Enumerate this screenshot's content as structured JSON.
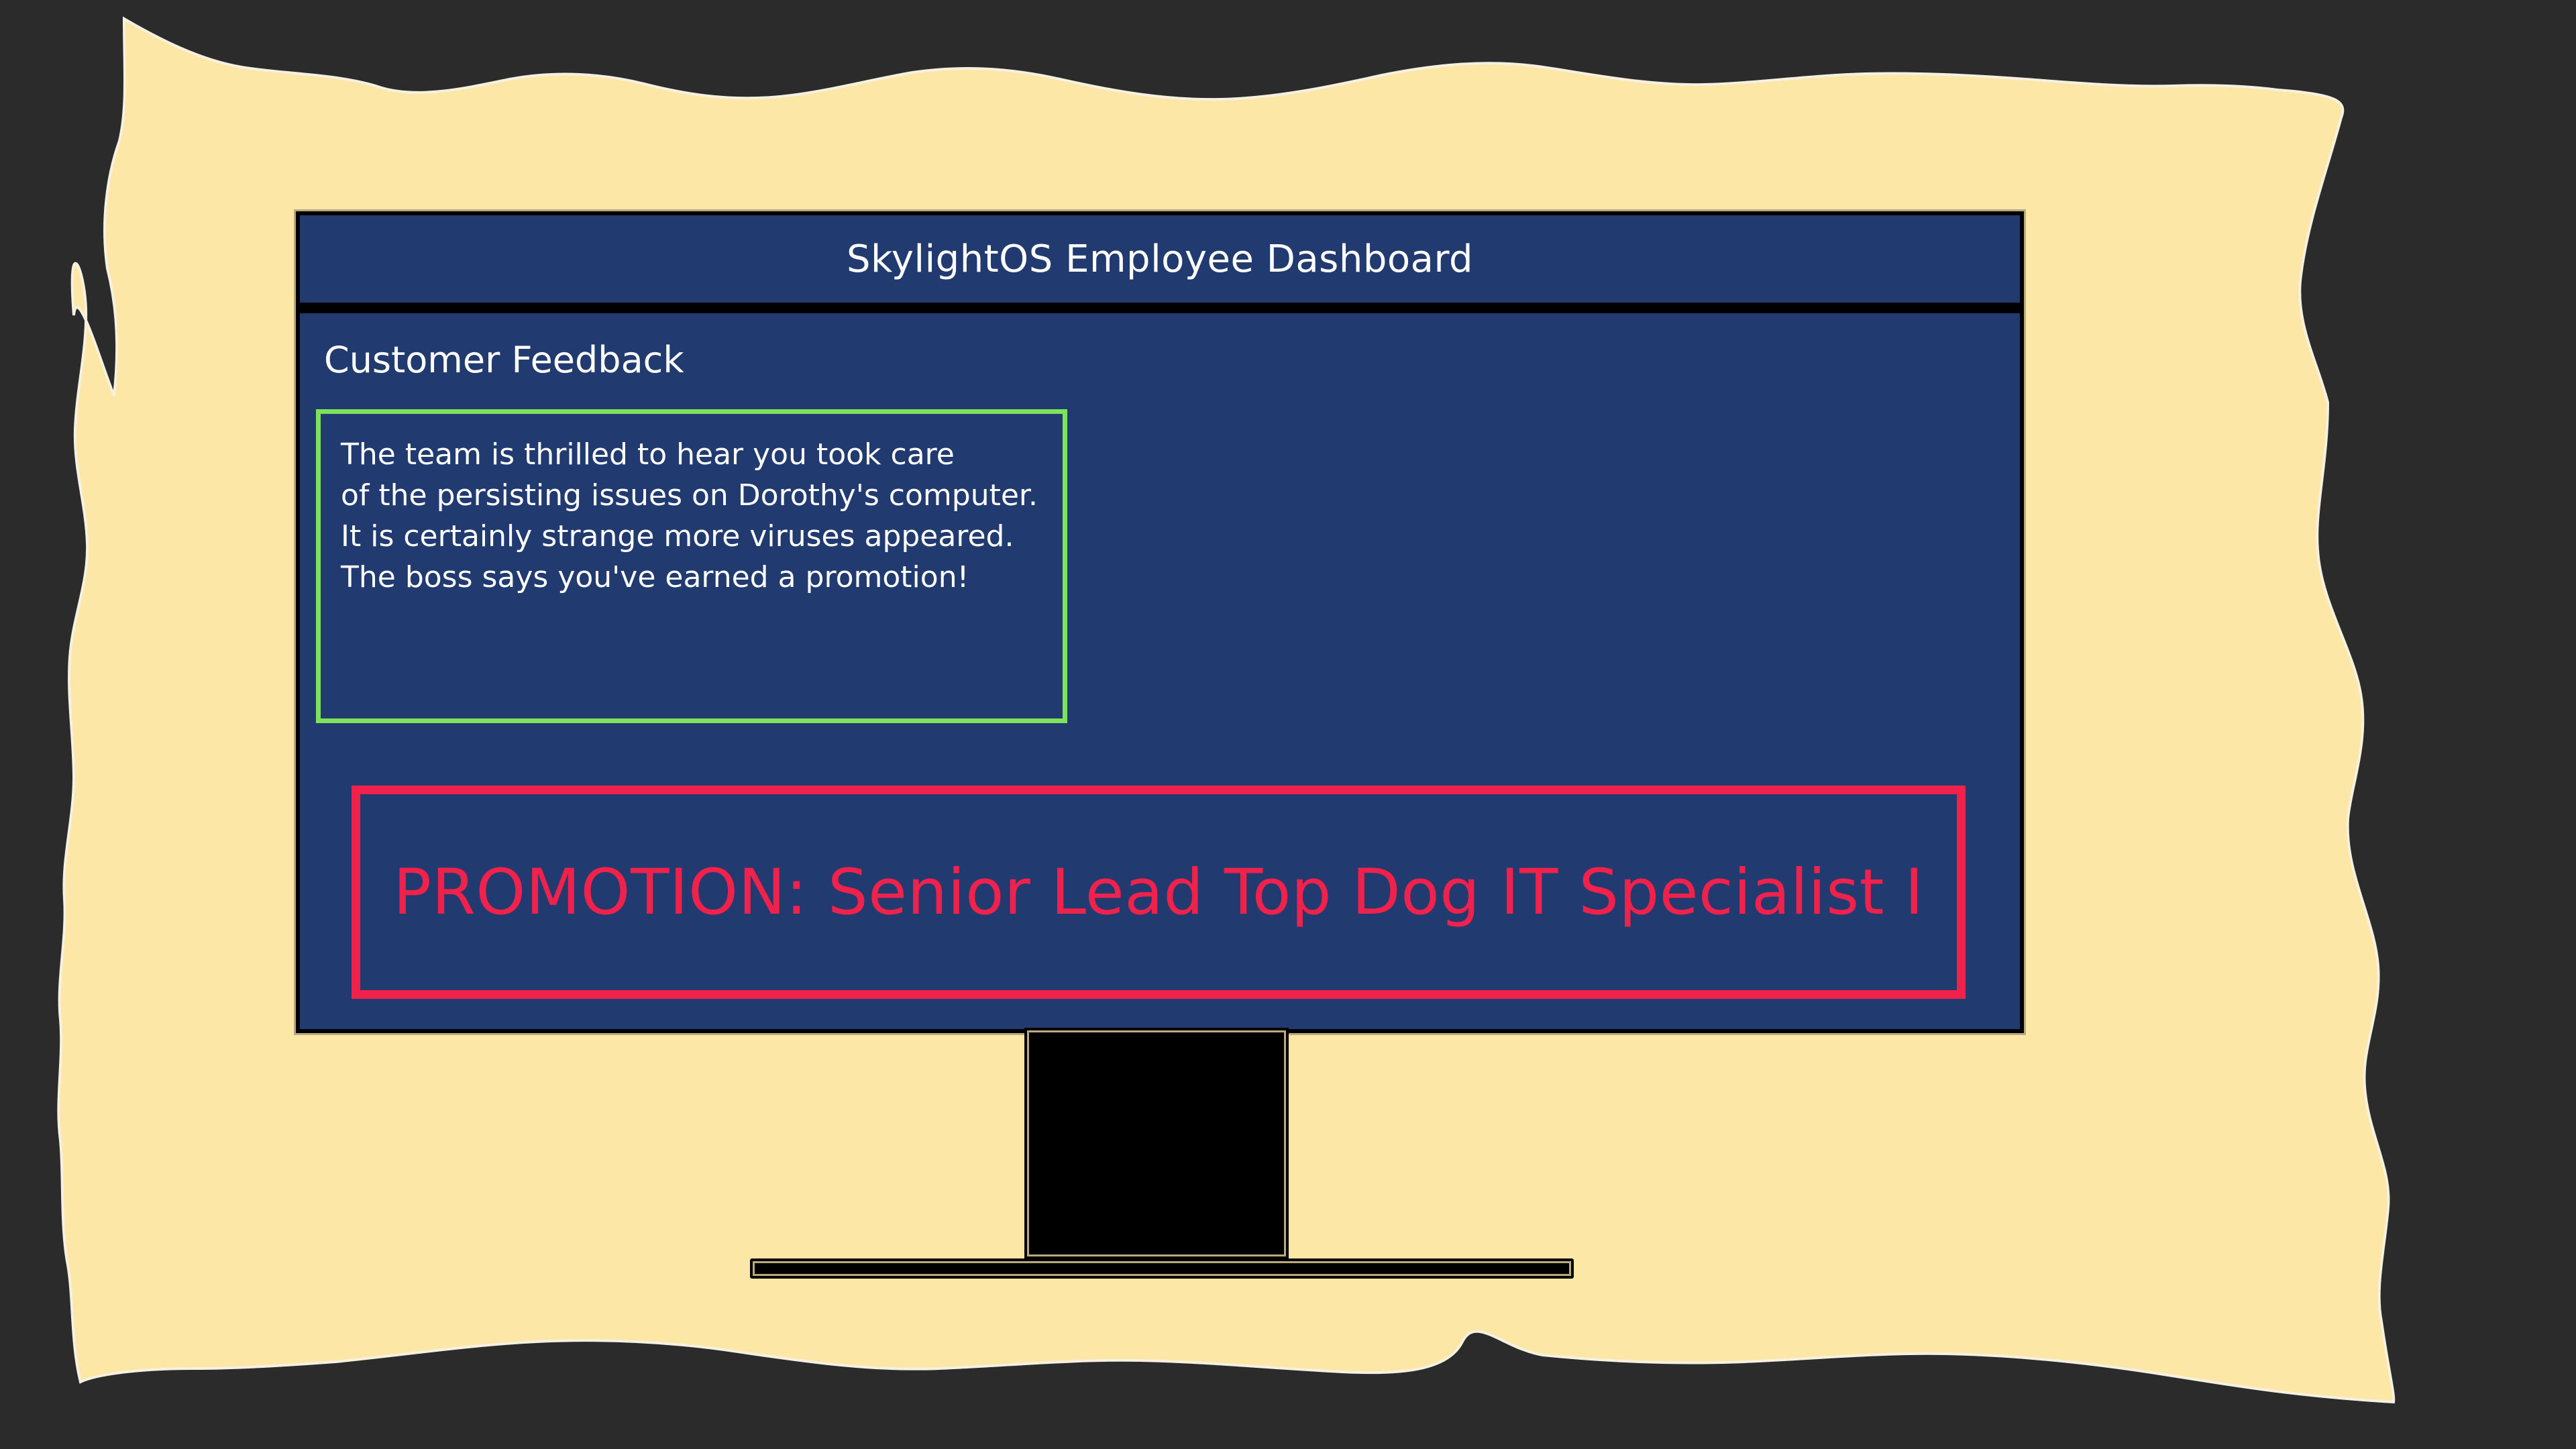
{
  "window": {
    "title": "SkylightOS Employee Dashboard"
  },
  "feedback": {
    "heading": "Customer Feedback",
    "lines": [
      "The team is thrilled to hear you took care",
      "of the persisting issues on Dorothy's computer.",
      "It is certainly strange more viruses appeared.",
      "The boss says you've earned a promotion!"
    ]
  },
  "promotion": {
    "text": "PROMOTION: Senior Lead Top Dog IT Specialist I"
  },
  "colors": {
    "background": "#2b2b2b",
    "paper": "#fde7a6",
    "screen": "#213a70",
    "feedback_border": "#7ee35a",
    "promotion": "#f0214b"
  },
  "icons": {
    "background_shape": "torn-paper",
    "device": "computer-monitor"
  }
}
